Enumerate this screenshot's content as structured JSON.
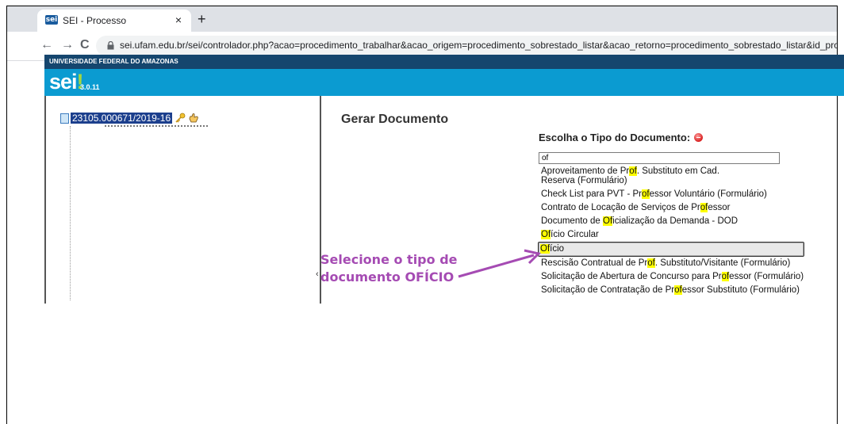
{
  "browser": {
    "tab_title": "SEI - Processo",
    "tab_favicon_text": "sei",
    "close_glyph": "×",
    "new_tab_glyph": "+",
    "back_glyph": "←",
    "forward_glyph": "→",
    "reload_glyph": "C",
    "url": "sei.ufam.edu.br/sei/controlador.php?acao=procedimento_trabalhar&acao_origem=procedimento_sobrestado_listar&acao_retorno=procedimento_sobrestado_listar&id_procedimento"
  },
  "sei": {
    "institution": "UNIVERSIDADE FEDERAL DO AMAZONAS",
    "logo": "sei",
    "logo_dot": "!",
    "version": "3.0.11",
    "accent_color": "#0b9bd1",
    "topbar_color": "#15466e"
  },
  "tree": {
    "process_number": "23105.000671/2019-16",
    "icons": [
      "document-icon",
      "key-icon",
      "hand-icon"
    ]
  },
  "content": {
    "title": "Gerar Documento",
    "choose_label": "Escolha o Tipo do Documento:",
    "filter_value": "of",
    "types": [
      {
        "before": "Aproveitamento de Pr",
        "hl": "of",
        "after": ". Substituto em Cad.",
        "line2": "Reserva (Formulário)"
      },
      {
        "before": "Check List para PVT - Pr",
        "hl": "of",
        "after": "essor Voluntário (Formulário)",
        "line2": ""
      },
      {
        "before": "Contrato de Locação de Serviços de Pr",
        "hl": "of",
        "after": "essor",
        "line2": ""
      },
      {
        "before": "Documento de ",
        "hl": "Of",
        "after": "icialização da Demanda - DOD",
        "line2": ""
      },
      {
        "before": "",
        "hl": "Of",
        "after": "ício Circular",
        "line2": ""
      },
      {
        "before": "",
        "hl": "Of",
        "after": "ício",
        "line2": "",
        "selected": true
      },
      {
        "before": "Rescisão Contratual de Pr",
        "hl": "of",
        "after": ". Substituto/Visitante (Formulário)",
        "line2": ""
      },
      {
        "before": "Solicitação de Abertura de Concurso para Pr",
        "hl": "of",
        "after": "essor (Formulário)",
        "line2": ""
      },
      {
        "before": "Solicitação de Contratação de Pr",
        "hl": "of",
        "after": "essor Substituto (Formulário)",
        "line2": ""
      }
    ],
    "scroll_marker": "‹"
  },
  "annotation": {
    "line1": "Selecione o tipo de",
    "line2": "documento OFÍCIO",
    "color": "#a54bb3"
  }
}
